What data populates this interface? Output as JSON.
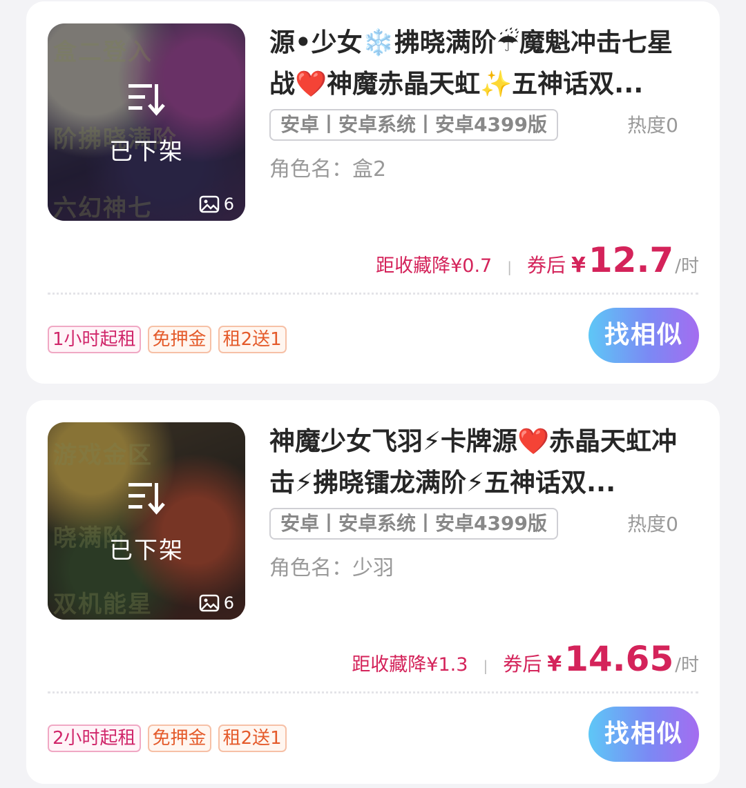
{
  "listings": [
    {
      "title": "源•少女❄️拂晓满阶☔魔魁冲击七星战❤️神魔赤晶天虹✨五神话双...",
      "status_label": "已下架",
      "image_count": "6",
      "platform": "安卓丨安卓系统丨安卓4399版",
      "heat": "热度0",
      "role": "角色名：盒2",
      "price_drop": "距收藏降¥0.7",
      "price_prefix": "券后",
      "currency": "¥",
      "price": "12.7",
      "price_unit": "/时",
      "tags": [
        "1小时起租",
        "免押金",
        "租2送1"
      ],
      "similar_label": "找相似"
    },
    {
      "title": "神魔少女飞羽⚡卡牌源❤️赤晶天虹冲击⚡拂晓镭龙满阶⚡五神话双...",
      "status_label": "已下架",
      "image_count": "6",
      "platform": "安卓丨安卓系统丨安卓4399版",
      "heat": "热度0",
      "role": "角色名：少羽",
      "price_drop": "距收藏降¥1.3",
      "price_prefix": "券后",
      "currency": "¥",
      "price": "14.65",
      "price_unit": "/时",
      "tags": [
        "2小时起租",
        "免押金",
        "租2送1"
      ],
      "similar_label": "找相似"
    }
  ]
}
